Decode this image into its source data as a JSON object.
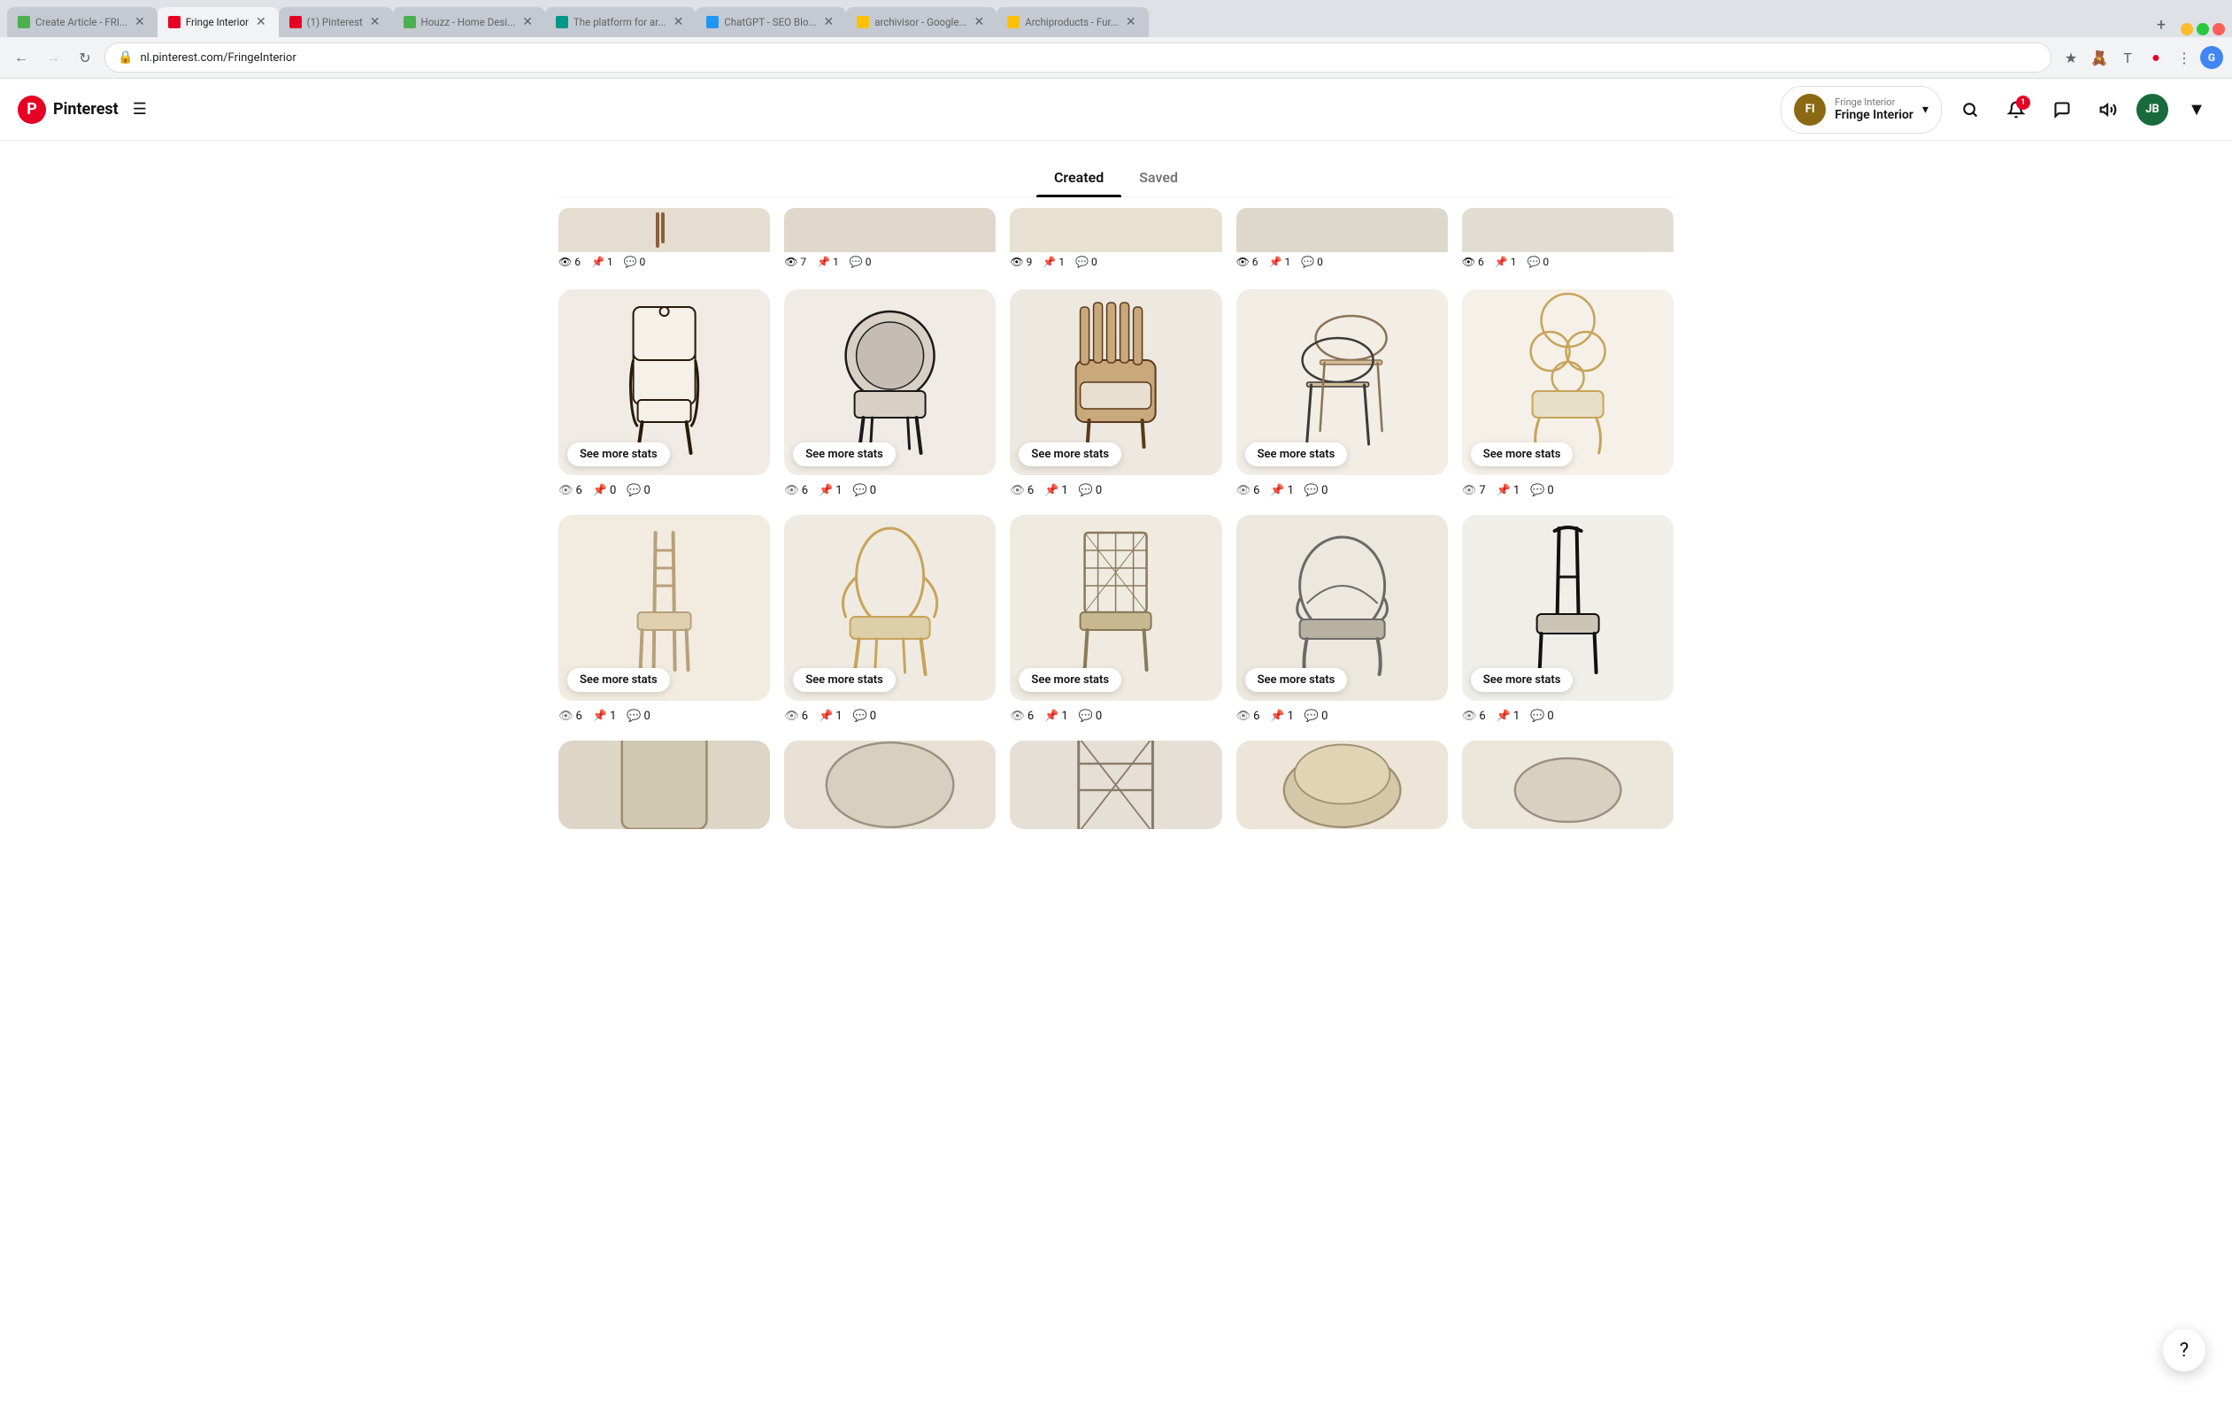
{
  "browser": {
    "tabs": [
      {
        "id": "tab-create",
        "title": "Create Article - FRI...",
        "favicon_color": "fav-green",
        "active": false
      },
      {
        "id": "tab-pinterest-fringe",
        "title": "Fringe Interior",
        "favicon_color": "fav-red",
        "active": true
      },
      {
        "id": "tab-pinterest-main",
        "title": "(1) Pinterest",
        "favicon_color": "fav-red",
        "active": false
      },
      {
        "id": "tab-houzz",
        "title": "Houzz - Home Desi...",
        "favicon_color": "fav-green",
        "active": false
      },
      {
        "id": "tab-platform",
        "title": "The platform for ar...",
        "favicon_color": "fav-teal",
        "active": false
      },
      {
        "id": "tab-chatgpt",
        "title": "ChatGPT - SEO Blo...",
        "favicon_color": "fav-blue",
        "active": false
      },
      {
        "id": "tab-archivisor",
        "title": "archivisor - Google...",
        "favicon_color": "fav-yellow",
        "active": false
      },
      {
        "id": "tab-archiproducts",
        "title": "Archiproducts - Fur...",
        "favicon_color": "fav-yellow",
        "active": false
      }
    ],
    "address": "nl.pinterest.com/FringeInterior",
    "new_tab_label": "+"
  },
  "header": {
    "logo_letter": "P",
    "wordmark": "Pinterest",
    "menu_icon": "☰",
    "account": {
      "top_label": "Fringe Interior",
      "name": "Fringe Interior",
      "avatar_initials": "FI",
      "chevron": "▾"
    },
    "icons": {
      "search": "🔍",
      "notifications": "🔔",
      "notification_count": "1",
      "messages": "💬",
      "updates": "🔊",
      "user_avatar_initials": "JB"
    }
  },
  "profile_tabs": [
    {
      "id": "tab-created",
      "label": "Created",
      "active": true
    },
    {
      "id": "tab-saved",
      "label": "Saved",
      "active": false
    }
  ],
  "partial_row": [
    {
      "views": 6,
      "saves": 1,
      "comments": 0
    },
    {
      "views": 7,
      "saves": 1,
      "comments": 0
    },
    {
      "views": 9,
      "saves": 1,
      "comments": 0
    },
    {
      "views": 6,
      "saves": 1,
      "comments": 0
    },
    {
      "views": 6,
      "saves": 1,
      "comments": 0
    }
  ],
  "pin_rows": [
    {
      "id": "row-1",
      "pins": [
        {
          "id": "p1",
          "views": 6,
          "saves": 0,
          "comments": 0,
          "btn": "See more stats",
          "chair_type": "high-back-upholstered"
        },
        {
          "id": "p2",
          "views": 6,
          "saves": 1,
          "comments": 0,
          "btn": "See more stats",
          "chair_type": "round-back-armchair"
        },
        {
          "id": "p3",
          "views": 6,
          "saves": 1,
          "comments": 0,
          "btn": "See more stats",
          "chair_type": "barrel-chair-wood"
        },
        {
          "id": "p4",
          "views": 6,
          "saves": 1,
          "comments": 0,
          "btn": "See more stats",
          "chair_type": "stacked-chairs"
        },
        {
          "id": "p5",
          "views": 7,
          "saves": 1,
          "comments": 0,
          "btn": "See more stats",
          "chair_type": "ornate-chair"
        }
      ]
    },
    {
      "id": "row-2",
      "pins": [
        {
          "id": "p6",
          "views": 6,
          "saves": 1,
          "comments": 0,
          "btn": "See more stats",
          "chair_type": "slim-wood-chair"
        },
        {
          "id": "p7",
          "views": 6,
          "saves": 1,
          "comments": 0,
          "btn": "See more stats",
          "chair_type": "oval-back-chair"
        },
        {
          "id": "p8",
          "views": 6,
          "saves": 1,
          "comments": 0,
          "btn": "See more stats",
          "chair_type": "wire-decorative-chair"
        },
        {
          "id": "p9",
          "views": 6,
          "saves": 1,
          "comments": 0,
          "btn": "See more stats",
          "chair_type": "curved-metal-chair"
        },
        {
          "id": "p10",
          "views": 6,
          "saves": 1,
          "comments": 0,
          "btn": "See more stats",
          "chair_type": "black-slim-chair"
        }
      ]
    },
    {
      "id": "row-3-partial",
      "pins": [
        {
          "id": "p11",
          "chair_type": "wicker-partial"
        },
        {
          "id": "p12",
          "chair_type": "round-ottoman-partial"
        },
        {
          "id": "p13",
          "chair_type": "geometric-partial"
        },
        {
          "id": "p14",
          "chair_type": "round-beige-partial"
        },
        {
          "id": "p15",
          "chair_type": "partial-right"
        }
      ]
    }
  ],
  "help": {
    "icon": "?"
  }
}
